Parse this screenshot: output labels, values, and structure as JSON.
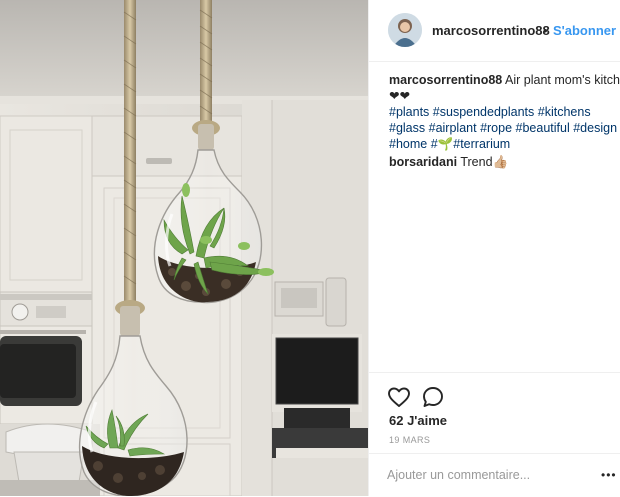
{
  "post": {
    "username": "marcosorrentino88",
    "separator": "•",
    "follow_label": "S'abonner",
    "caption": {
      "username": "marcosorrentino88",
      "text": "Air plant mom's kitchen",
      "hearts": "❤❤",
      "hashtags_line1": [
        "#plants",
        "#suspendedplants",
        "#kitchens"
      ],
      "hashtags_line2": [
        "#glass",
        "#airplant",
        "#rope",
        "#beautiful",
        "#design"
      ],
      "hashtag_home": "#home",
      "hashtag_hash": "#",
      "sprout_emoji": "🌱",
      "hashtag_terrarium": "#terrarium"
    },
    "comments": [
      {
        "username": "borsaridani",
        "text": "Trend",
        "emoji": "👍🏼"
      }
    ],
    "likes": "62 J'aime",
    "date": "19 MARS",
    "add_comment_placeholder": "Ajouter un commentaire...",
    "more_label": "•••",
    "icons": {
      "like": "heart-icon",
      "comment": "comment-icon",
      "more": "more-options-icon",
      "avatar": "avatar"
    },
    "colors": {
      "link_blue": "#3897f0",
      "hashtag": "#003569",
      "text": "#262626",
      "muted": "#999999"
    }
  }
}
